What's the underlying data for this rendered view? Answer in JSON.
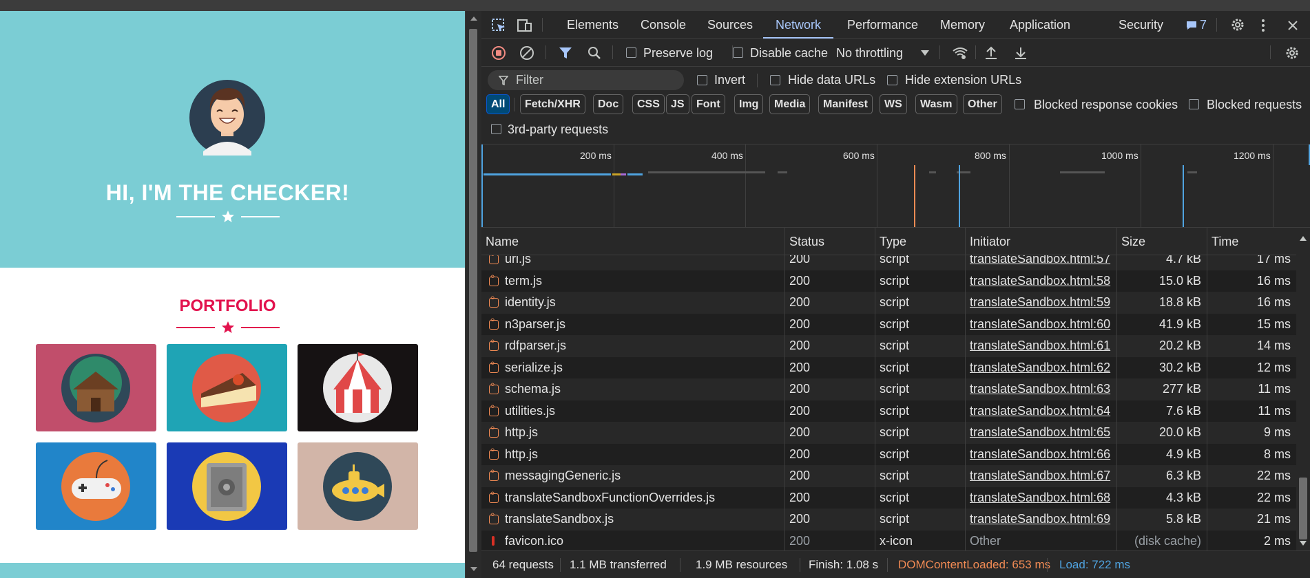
{
  "page": {
    "hero_title": "HI, I'M THE CHECKER!",
    "portfolio_title": "PORTFOLIO",
    "colors": {
      "hero_bg": "#7bcdd4",
      "accent": "#e2124d"
    },
    "tiles": [
      {
        "name": "cabin",
        "bg": "#c14e6b"
      },
      {
        "name": "cake",
        "bg": "#1fa4b5"
      },
      {
        "name": "circus-tent",
        "bg": "#161213"
      },
      {
        "name": "game-controller",
        "bg": "#2185c9"
      },
      {
        "name": "safe",
        "bg": "#1a3ab5"
      },
      {
        "name": "submarine",
        "bg": "#d2b5a8"
      }
    ]
  },
  "devtools": {
    "tabs": [
      "Elements",
      "Console",
      "Sources",
      "Network",
      "Performance",
      "Memory",
      "Application",
      "Security"
    ],
    "active_tab": "Network",
    "issues_count": "7",
    "toolbar": {
      "preserve_log": "Preserve log",
      "disable_cache": "Disable cache",
      "throttling": "No throttling"
    },
    "filter": {
      "placeholder": "Filter",
      "invert": "Invert",
      "hide_data_urls": "Hide data URLs",
      "hide_extension_urls": "Hide extension URLs"
    },
    "types": [
      "All",
      "Fetch/XHR",
      "Doc",
      "CSS",
      "JS",
      "Font",
      "Img",
      "Media",
      "Manifest",
      "WS",
      "Wasm",
      "Other"
    ],
    "blocked_cookies": "Blocked response cookies",
    "blocked_requests": "Blocked requests",
    "third_party": "3rd-party requests",
    "timeline_labels": [
      "200 ms",
      "400 ms",
      "600 ms",
      "800 ms",
      "1000 ms",
      "1200 ms"
    ],
    "columns": [
      "Name",
      "Status",
      "Type",
      "Initiator",
      "Size",
      "Time"
    ],
    "rows": [
      {
        "name": "uri.js",
        "status": "200",
        "type": "script",
        "initiator": "translateSandbox.html:57",
        "size": "4.7 kB",
        "time": "17 ms"
      },
      {
        "name": "term.js",
        "status": "200",
        "type": "script",
        "initiator": "translateSandbox.html:58",
        "size": "15.0 kB",
        "time": "16 ms"
      },
      {
        "name": "identity.js",
        "status": "200",
        "type": "script",
        "initiator": "translateSandbox.html:59",
        "size": "18.8 kB",
        "time": "16 ms"
      },
      {
        "name": "n3parser.js",
        "status": "200",
        "type": "script",
        "initiator": "translateSandbox.html:60",
        "size": "41.9 kB",
        "time": "15 ms"
      },
      {
        "name": "rdfparser.js",
        "status": "200",
        "type": "script",
        "initiator": "translateSandbox.html:61",
        "size": "20.2 kB",
        "time": "14 ms"
      },
      {
        "name": "serialize.js",
        "status": "200",
        "type": "script",
        "initiator": "translateSandbox.html:62",
        "size": "30.2 kB",
        "time": "12 ms"
      },
      {
        "name": "schema.js",
        "status": "200",
        "type": "script",
        "initiator": "translateSandbox.html:63",
        "size": "277 kB",
        "time": "11 ms"
      },
      {
        "name": "utilities.js",
        "status": "200",
        "type": "script",
        "initiator": "translateSandbox.html:64",
        "size": "7.6 kB",
        "time": "11 ms"
      },
      {
        "name": "http.js",
        "status": "200",
        "type": "script",
        "initiator": "translateSandbox.html:65",
        "size": "20.0 kB",
        "time": "9 ms"
      },
      {
        "name": "http.js",
        "status": "200",
        "type": "script",
        "initiator": "translateSandbox.html:66",
        "size": "4.9 kB",
        "time": "8 ms"
      },
      {
        "name": "messagingGeneric.js",
        "status": "200",
        "type": "script",
        "initiator": "translateSandbox.html:67",
        "size": "6.3 kB",
        "time": "22 ms"
      },
      {
        "name": "translateSandboxFunctionOverrides.js",
        "status": "200",
        "type": "script",
        "initiator": "translateSandbox.html:68",
        "size": "4.3 kB",
        "time": "22 ms"
      },
      {
        "name": "translateSandbox.js",
        "status": "200",
        "type": "script",
        "initiator": "translateSandbox.html:69",
        "size": "5.8 kB",
        "time": "21 ms"
      },
      {
        "name": "favicon.ico",
        "status": "200",
        "type": "x-icon",
        "initiator": "Other",
        "size": "(disk cache)",
        "time": "2 ms"
      }
    ],
    "status": {
      "requests": "64 requests",
      "transferred": "1.1 MB transferred",
      "resources": "1.9 MB resources",
      "finish": "Finish: 1.08 s",
      "dcl": "DOMContentLoaded: 653 ms",
      "load": "Load: 722 ms"
    }
  }
}
